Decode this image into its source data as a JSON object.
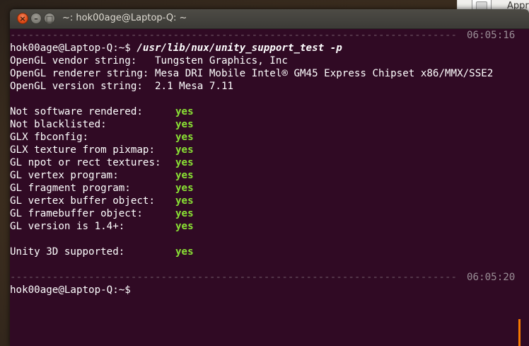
{
  "desktop": {
    "panel_label": "Appr"
  },
  "window": {
    "title": "~: hok00age@Laptop-Q: ~",
    "close_glyph": "×",
    "min_glyph": "–",
    "max_glyph": "□"
  },
  "terminal": {
    "separator_1": {
      "dashes": "------------------------------------------------------------------------------------------------",
      "time": "06:05:16"
    },
    "prompt": "hok00age@Laptop-Q:~$ ",
    "command": "/usr/lib/nux/unity_support_test -p",
    "vendor_line": "OpenGL vendor string:   Tungsten Graphics, Inc",
    "renderer_line": "OpenGL renderer string: Mesa DRI Mobile Intel® GM45 Express Chipset x86/MMX/SSE2",
    "version_line": "OpenGL version string:  2.1 Mesa 7.11",
    "checks": [
      {
        "label": "Not software rendered:",
        "value": "yes"
      },
      {
        "label": "Not blacklisted:",
        "value": "yes"
      },
      {
        "label": "GLX fbconfig:",
        "value": "yes"
      },
      {
        "label": "GLX texture from pixmap:",
        "value": "yes"
      },
      {
        "label": "GL npot or rect textures:",
        "value": "yes"
      },
      {
        "label": "GL vertex program:",
        "value": "yes"
      },
      {
        "label": "GL fragment program:",
        "value": "yes"
      },
      {
        "label": "GL vertex buffer object:",
        "value": "yes"
      },
      {
        "label": "GL framebuffer object:",
        "value": "yes"
      },
      {
        "label": "GL version is 1.4+:",
        "value": "yes"
      }
    ],
    "unity_check": {
      "label": "Unity 3D supported:",
      "value": "yes"
    },
    "separator_2": {
      "dashes": "------------------------------------------------------------------------------------------------",
      "time": "06:05:20"
    },
    "final_prompt": "hok00age@Laptop-Q:~$"
  },
  "colors": {
    "terminal_bg": "#300a24",
    "ok_green": "#8ae234",
    "close_orange": "#df4a16",
    "scroll_orange": "#f57900"
  }
}
